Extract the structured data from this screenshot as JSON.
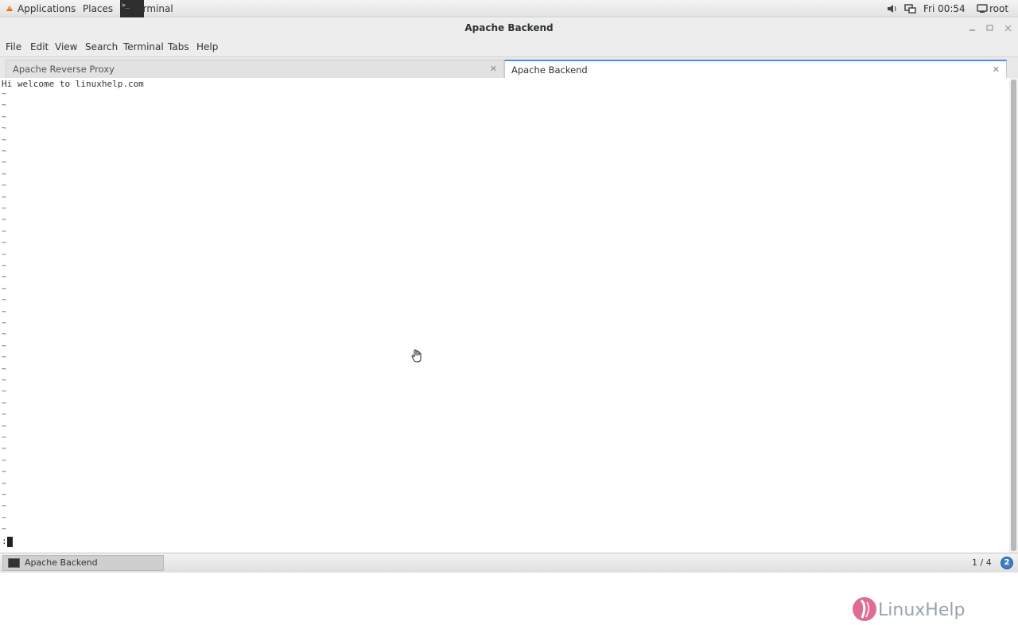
{
  "top_panel": {
    "applications_label": "Applications",
    "places_label": "Places",
    "task_label": "Terminal",
    "clock": "Fri 00:54",
    "user": "root"
  },
  "window": {
    "title": "Apache Backend",
    "minimize_icon": "minimize-icon",
    "maximize_icon": "maximize-icon",
    "close_icon": "close-icon"
  },
  "menu": {
    "items": [
      "File",
      "Edit",
      "View",
      "Search",
      "Terminal",
      "Tabs",
      "Help"
    ]
  },
  "tabs": [
    {
      "label": "Apache Reverse Proxy",
      "active": false
    },
    {
      "label": "Apache Backend",
      "active": true
    }
  ],
  "terminal": {
    "first_line": "Hi welcome to linuxhelp.com",
    "tilde": "~",
    "command_prompt": ":"
  },
  "watermark": {
    "text": "LinuxHelp"
  },
  "bottom_panel": {
    "task_label": "Apache Backend",
    "workspace": "1 / 4",
    "notification_count": "2"
  },
  "colors": {
    "accent": "#4a90d9",
    "logo_pink": "#d9537f",
    "logo_text": "#9aa3ad"
  }
}
